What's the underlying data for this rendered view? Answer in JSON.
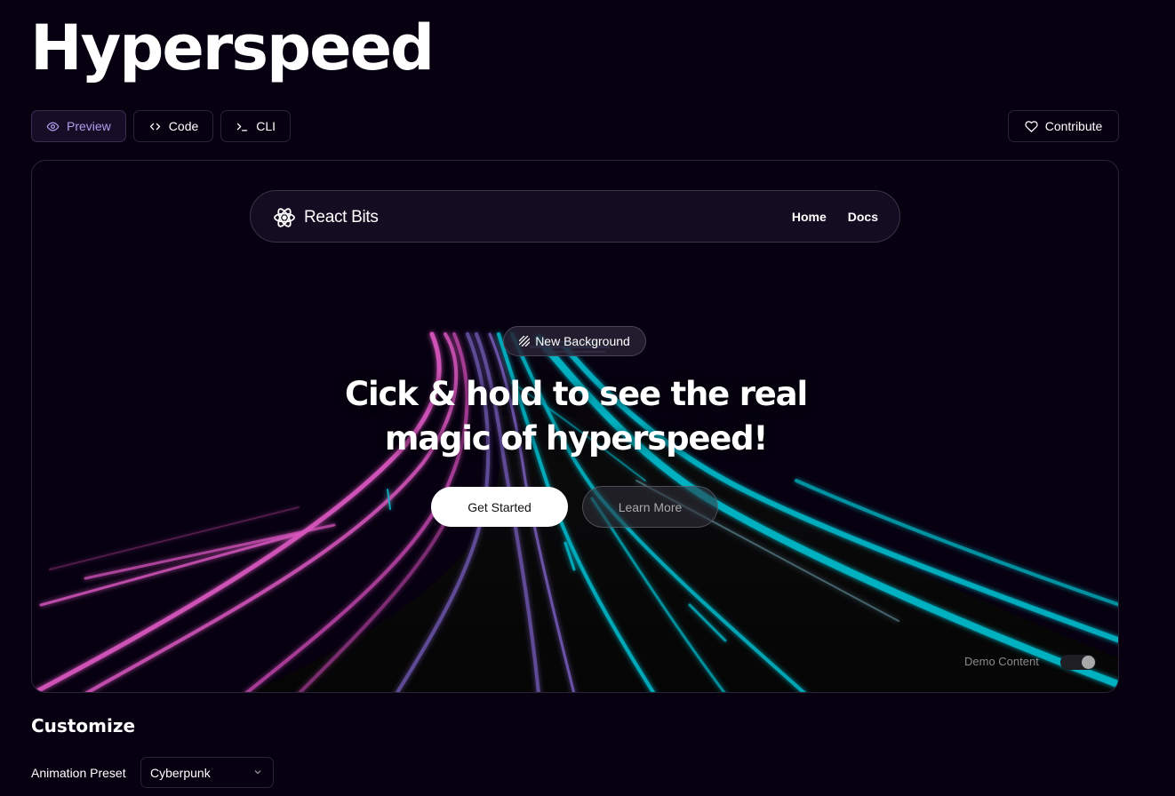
{
  "header": {
    "title": "Hyperspeed"
  },
  "tabs": [
    {
      "label": "Preview",
      "icon": "eye-icon",
      "active": true
    },
    {
      "label": "Code",
      "icon": "code-icon",
      "active": false
    },
    {
      "label": "CLI",
      "icon": "terminal-icon",
      "active": false
    }
  ],
  "contribute": {
    "label": "Contribute",
    "icon": "heart-icon"
  },
  "preview": {
    "navbar": {
      "brand": "React Bits",
      "brand_icon": "atom-logo-icon",
      "links": [
        "Home",
        "Docs"
      ]
    },
    "badge": {
      "label": "New Background",
      "icon": "stripes-icon"
    },
    "headline": {
      "line1": "Cick & hold to see the real",
      "line2": "magic of hyperspeed!"
    },
    "cta_primary": "Get Started",
    "cta_secondary": "Learn More",
    "demo_toggle": {
      "label": "Demo Content",
      "on": true
    }
  },
  "customize": {
    "title": "Customize",
    "preset_label": "Animation Preset",
    "preset_value": "Cyberpunk"
  },
  "colors": {
    "background": "#060010",
    "accent": "#b19eef",
    "left_lights": "#d856bf",
    "right_lights": "#03b3c3",
    "mid_lights": "#6750a2"
  }
}
